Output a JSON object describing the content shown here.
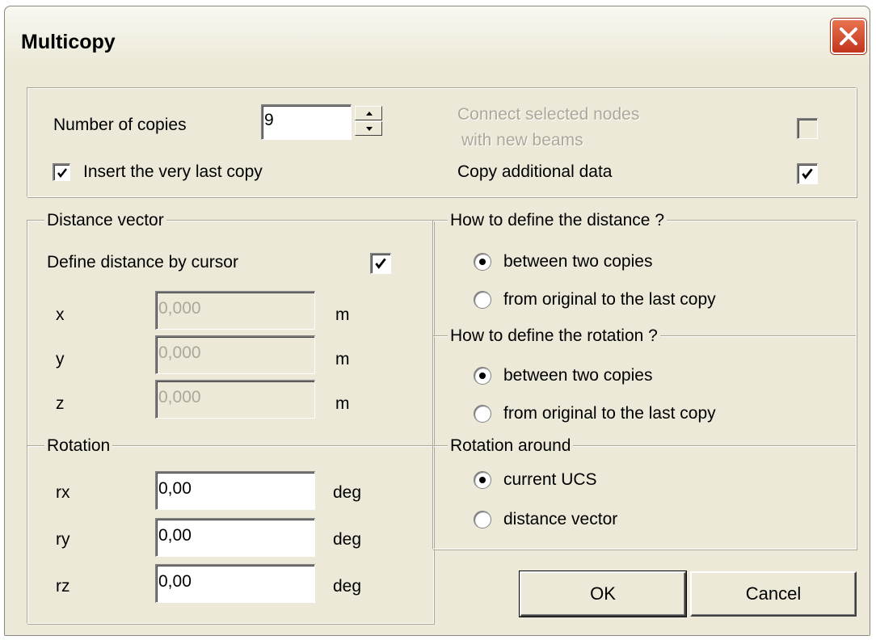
{
  "window": {
    "title": "Multicopy"
  },
  "top": {
    "number_of_copies_label": "Number of copies",
    "number_of_copies_value": "9",
    "insert_last_copy_label": "Insert the very last copy",
    "insert_last_copy_checked": true,
    "connect_nodes_line1": "Connect selected nodes",
    "connect_nodes_line2": "with new beams",
    "connect_nodes_checked": false,
    "copy_additional_label": "Copy additional data",
    "copy_additional_checked": true
  },
  "distance_vector": {
    "legend": "Distance vector",
    "define_by_cursor_label": "Define distance by cursor",
    "define_by_cursor_checked": true,
    "fields": [
      {
        "label": "x",
        "value": "0,000",
        "unit": "m"
      },
      {
        "label": "y",
        "value": "0,000",
        "unit": "m"
      },
      {
        "label": "z",
        "value": "0,000",
        "unit": "m"
      }
    ]
  },
  "rotation": {
    "legend": "Rotation",
    "fields": [
      {
        "label": "rx",
        "value": "0,00",
        "unit": "deg"
      },
      {
        "label": "ry",
        "value": "0,00",
        "unit": "deg"
      },
      {
        "label": "rz",
        "value": "0,00",
        "unit": "deg"
      }
    ]
  },
  "distance_mode": {
    "legend": "How to define the distance ?",
    "options": [
      {
        "label": "between two copies",
        "selected": true
      },
      {
        "label": "from original to the last copy",
        "selected": false
      }
    ]
  },
  "rotation_mode": {
    "legend": "How to define the rotation ?",
    "options": [
      {
        "label": "between two copies",
        "selected": true
      },
      {
        "label": "from original to the last copy",
        "selected": false
      }
    ]
  },
  "rotation_around": {
    "legend": "Rotation around",
    "options": [
      {
        "label": "current UCS",
        "selected": true
      },
      {
        "label": "distance vector",
        "selected": false
      }
    ]
  },
  "buttons": {
    "ok": "OK",
    "cancel": "Cancel"
  },
  "colors": {
    "dialog_bg": "#ece9d8",
    "close_button": "#c2351d",
    "disabled_text": "#aca899"
  }
}
